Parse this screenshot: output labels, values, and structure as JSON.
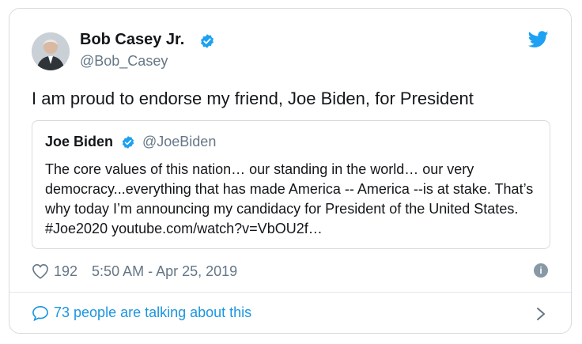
{
  "author": {
    "name": "Bob Casey Jr.",
    "handle": "@Bob_Casey"
  },
  "tweet_text": "I am proud to endorse my friend, Joe Biden, for President",
  "quoted": {
    "name": "Joe Biden",
    "handle": "@JoeBiden",
    "text": "The core values of this nation… our standing in the world… our very democracy...everything that has made America -- America --is at stake. That’s why today I’m announcing my candidacy for President of the United States. #Joe2020 youtube.com/watch?v=VbOU2f…"
  },
  "meta": {
    "likes": "192",
    "timestamp": "5:50 AM - Apr 25, 2019"
  },
  "conversation": {
    "label": "73 people are talking about this"
  },
  "colors": {
    "accent": "#1da1f2",
    "link": "#1b95e0",
    "muted": "#657786"
  },
  "icons": [
    "twitter-bird-icon",
    "verified-badge-icon",
    "heart-icon",
    "info-icon",
    "comment-bubble-icon",
    "chevron-right-icon"
  ]
}
